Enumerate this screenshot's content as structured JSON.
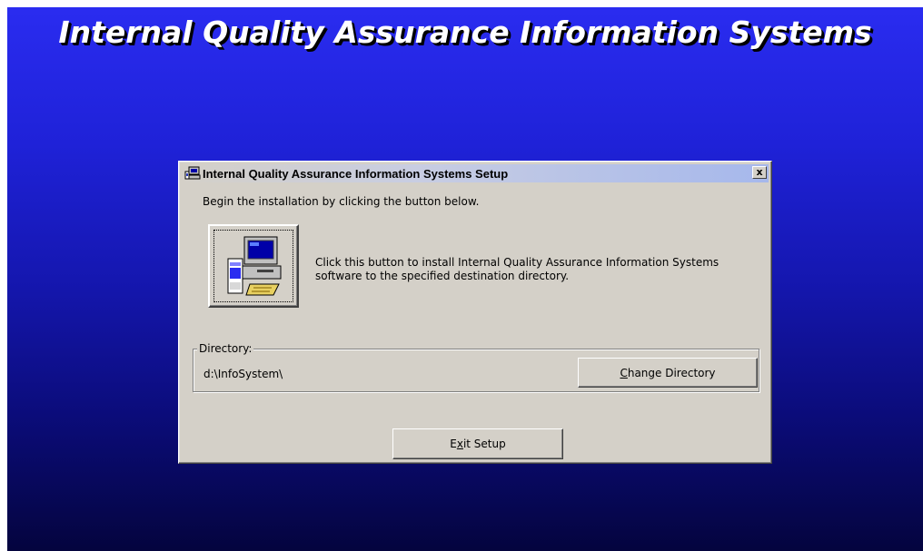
{
  "banner": {
    "title": "Internal Quality Assurance Information Systems"
  },
  "dialog": {
    "title": "Internal Quality Assurance Information Systems Setup",
    "close_label": "x",
    "message": "Begin the installation by clicking the button below.",
    "install_description": "Click this button to install Internal Quality Assurance Information Systems software to the specified destination directory.",
    "directory_group_label": "Directory:",
    "directory_value": "d:\\InfoSystem\\",
    "change_directory": {
      "mnemonic": "C",
      "rest": "hange Directory"
    },
    "exit_setup": {
      "before": "E",
      "mnemonic": "x",
      "rest": "it Setup"
    }
  },
  "colors": {
    "desktop_top": "#2a2cf0",
    "desktop_bottom": "#04043e",
    "dialog_face": "#d4d0c8",
    "titlebar_end": "#a6b8ec"
  },
  "icons": {
    "title_icon": "setup-computer-icon",
    "install_icon": "computer-install-icon"
  }
}
